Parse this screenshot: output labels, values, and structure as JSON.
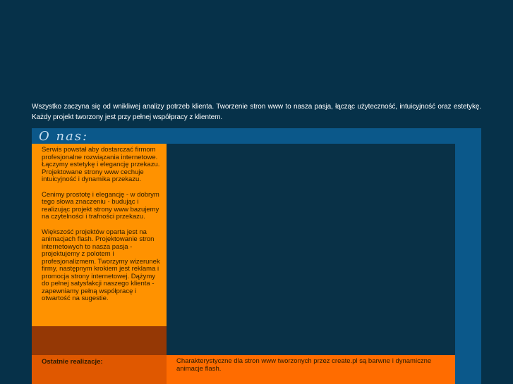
{
  "intro": {
    "text": "Wszystko zaczyna się od wnikliwej analizy potrzeb klienta. Tworzenie stron www to nasza pasja, łącząc użyteczność, intuicyjność oraz estetykę. Każdy projekt tworzony jest przy pełnej współpracy z klientem."
  },
  "about": {
    "title": "O nas:",
    "paragraphs": [
      "Serwis powstał aby dostarczać firmom profesjonalne rozwiązania internetowe. Łączymy estetykę i elegancję przekazu. Projektowane strony www cechuje intuicyjność i dynamika przekazu.",
      "Cenimy prostotę i elegancję - w dobrym tego słowa znaczeniu - budując i realizując projekt strony www bazujemy na czytelności i trafności przekazu.",
      "Większość projektów oparta jest na animacjach flash. Projektowanie stron internetowych to nasza pasja - projektujemy z polotem i profesjonalizmem. Tworzymy wizerunek firmy, następnym krokiem jest reklama i promocja strony internetowej. Dążymy do pełnej satysfakcji naszego klienta - zapewniamy pełną współpracę i otwartość na sugestie."
    ]
  },
  "recent": {
    "label": "Ostatnie realizacje:"
  },
  "footer_note": {
    "text": "Charakterystyczne dla stron www tworzonych przez create.pl są barwne i dynamiczne animacje flash."
  },
  "colors": {
    "background": "#063149",
    "panel": "#0b588a",
    "orange": "#ff9200",
    "dark_orange": "#953805",
    "footer_orange": "#ff6c00"
  }
}
